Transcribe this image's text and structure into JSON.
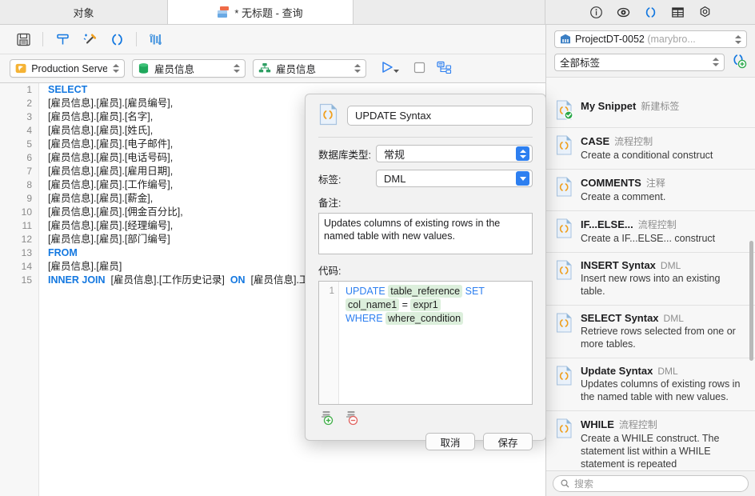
{
  "tabs": {
    "objects": "对象",
    "query": "* 无标题 - 查询"
  },
  "header_icons": [
    "info-icon",
    "eye-icon",
    "snippet-icon",
    "table-icon",
    "settings-icon"
  ],
  "toolbar": {
    "save": "save-icon",
    "format": "format-icon",
    "beautify": "beautify-icon",
    "snippet": "snippet-icon",
    "chart": "chart-icon"
  },
  "selectors": {
    "connection": "Production Server",
    "database": "雇员信息",
    "schema": "雇员信息",
    "run": "run-icon",
    "stop": "stop-icon",
    "explain": "explain-icon"
  },
  "editor": {
    "lines": [
      {
        "n": "1",
        "kw": "SELECT",
        "rest": ""
      },
      {
        "n": "2",
        "kw": "",
        "rest": "[雇员信息].[雇员].[雇员编号],"
      },
      {
        "n": "3",
        "kw": "",
        "rest": "[雇员信息].[雇员].[名字],"
      },
      {
        "n": "4",
        "kw": "",
        "rest": "[雇员信息].[雇员].[姓氏],"
      },
      {
        "n": "5",
        "kw": "",
        "rest": "[雇员信息].[雇员].[电子邮件],"
      },
      {
        "n": "6",
        "kw": "",
        "rest": "[雇员信息].[雇员].[电话号码],"
      },
      {
        "n": "7",
        "kw": "",
        "rest": "[雇员信息].[雇员].[雇用日期],"
      },
      {
        "n": "8",
        "kw": "",
        "rest": "[雇员信息].[雇员].[工作编号],"
      },
      {
        "n": "9",
        "kw": "",
        "rest": "[雇员信息].[雇员].[薪金],"
      },
      {
        "n": "10",
        "kw": "",
        "rest": "[雇员信息].[雇员].[佣金百分比],"
      },
      {
        "n": "11",
        "kw": "",
        "rest": "[雇员信息].[雇员].[经理编号],"
      },
      {
        "n": "12",
        "kw": "",
        "rest": "[雇员信息].[雇员].[部门编号]"
      },
      {
        "n": "13",
        "kw": "FROM",
        "rest": ""
      },
      {
        "n": "14",
        "kw": "",
        "rest": "[雇员信息].[雇员]"
      },
      {
        "n": "15",
        "kw": "INNER JOIN",
        "rest": "  [雇员信息].[工作历史记录]  ",
        "kw2": "ON",
        "rest2": "  [雇员信息].工"
      }
    ]
  },
  "dialog": {
    "icon": "snippet-icon",
    "title_value": "UPDATE Syntax",
    "db_type_label": "数据库类型:",
    "db_type_value": "常规",
    "tag_label": "标签:",
    "tag_value": "DML",
    "notes_label": "备注:",
    "notes_value": "Updates columns of existing rows in the named table with new values.",
    "code_label": "代码:",
    "code_line_number": "1",
    "code": {
      "kw1": "UPDATE",
      "tok1": "table_reference",
      "kw2": "SET",
      "tok2": "col_name1",
      "eq": "=",
      "tok3": "expr1",
      "kw3": "WHERE",
      "tok4": "where_condition"
    },
    "add_btn": "add-snippet-icon",
    "remove_btn": "remove-snippet-icon",
    "cancel": "取消",
    "save": "保存"
  },
  "sidebar": {
    "project_value": "ProjectDT-0052",
    "project_suffix": "(marybro...",
    "tag_filter": "全部标签",
    "new_snippet_icon": "new-snippet-icon",
    "search_placeholder": "搜索",
    "snippets": [
      {
        "title": "My Snippet",
        "cat": "新建标签",
        "desc": "",
        "selected": true
      },
      {
        "title": "CASE",
        "cat": "流程控制",
        "desc": "Create a conditional construct"
      },
      {
        "title": "COMMENTS",
        "cat": "注释",
        "desc": "Create a comment."
      },
      {
        "title": "IF...ELSE...",
        "cat": "流程控制",
        "desc": "Create a IF...ELSE... construct"
      },
      {
        "title": "INSERT Syntax",
        "cat": "DML",
        "desc": "Insert new rows into an existing table."
      },
      {
        "title": "SELECT Syntax",
        "cat": "DML",
        "desc": "Retrieve rows selected from one or more tables."
      },
      {
        "title": "Update Syntax",
        "cat": "DML",
        "desc": "Updates columns of existing rows in the named table with new values."
      },
      {
        "title": "WHILE",
        "cat": "流程控制",
        "desc": "Create a WHILE construct. The statement list within a WHILE statement is repeated"
      }
    ]
  },
  "colors": {
    "accent": "#2d7ff0",
    "keyword": "#1478e0",
    "token_bg": "#dcefdc",
    "chrome": "#f6f6f6"
  }
}
